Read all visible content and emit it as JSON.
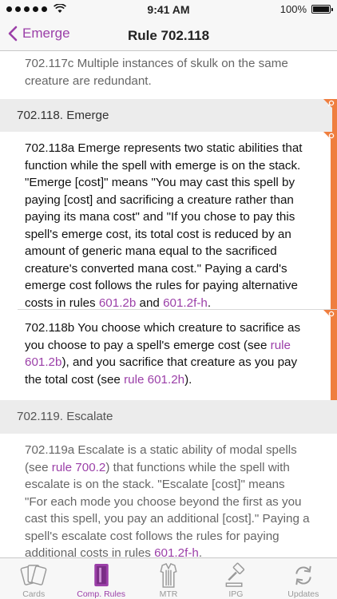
{
  "status_bar": {
    "time": "9:41 AM",
    "battery": "100%",
    "signal_icon": "signal-dots-icon",
    "wifi_icon": "wifi-icon",
    "battery_icon": "battery-icon"
  },
  "nav": {
    "back_label": "Emerge",
    "title": "Rule 702.118"
  },
  "colors": {
    "accent": "#9b3fa8",
    "highlight_tag": "#ef7e3f",
    "section_bg": "#ececec"
  },
  "content": {
    "prev_rule": {
      "lines": [
        "702.117c Multiple instances of skulk on the same",
        "creature are redundant."
      ]
    },
    "section_702_118": "702.118. Emerge",
    "rule_a": {
      "lines": [
        "702.118a Emerge represents two static abilities that",
        "function while the spell with emerge is on the stack.",
        "\"Emerge [cost]\" means \"You may cast this spell by",
        "paying [cost] and sacrificing a creature rather than",
        "paying its mana cost\" and \"If you chose to pay this",
        "spell's emerge cost, its total cost is reduced by an",
        "amount of generic mana equal to the sacrificed",
        "creature's converted mana cost.\" Paying a card's",
        "emerge cost follows the rules for paying alternative"
      ],
      "last_line_prefix": "costs in rules ",
      "link1": "601.2b",
      "mid": " and ",
      "link2": "601.2f-h",
      "end": "."
    },
    "rule_b": {
      "line1": "702.118b You choose which creature to sacrifice as",
      "line2_prefix": "you choose to pay a spell's emerge cost (see ",
      "link1a": "rule",
      "link1b": "601.2b",
      "line3_mid": "), and you sacrifice that creature as you pay",
      "line4_prefix": "the total cost (see ",
      "link2": "rule 601.2h",
      "line4_end": ")."
    },
    "section_702_119": "702.119. Escalate",
    "rule_119a": {
      "line1": "702.119a Escalate is a static ability of modal spells",
      "line2_prefix": "(see ",
      "link1": "rule 700.2",
      "line2_end": ") that functions while the spell with",
      "lines_mid": [
        "escalate is on the stack. \"Escalate [cost]\" means",
        "\"For each mode you choose beyond the first as you",
        "cast this spell, you pay an additional [cost].\" Paying a",
        "spell's escalate cost follows the rules for paying"
      ],
      "last_prefix": "additional costs in rules ",
      "link2": "601.2f-h",
      "last_end": "."
    }
  },
  "tabs": [
    {
      "label": "Cards",
      "icon": "cards-icon"
    },
    {
      "label": "Comp. Rules",
      "icon": "rulebook-icon"
    },
    {
      "label": "MTR",
      "icon": "tournament-rules-icon"
    },
    {
      "label": "IPG",
      "icon": "gavel-icon"
    },
    {
      "label": "Updates",
      "icon": "refresh-icon"
    }
  ]
}
